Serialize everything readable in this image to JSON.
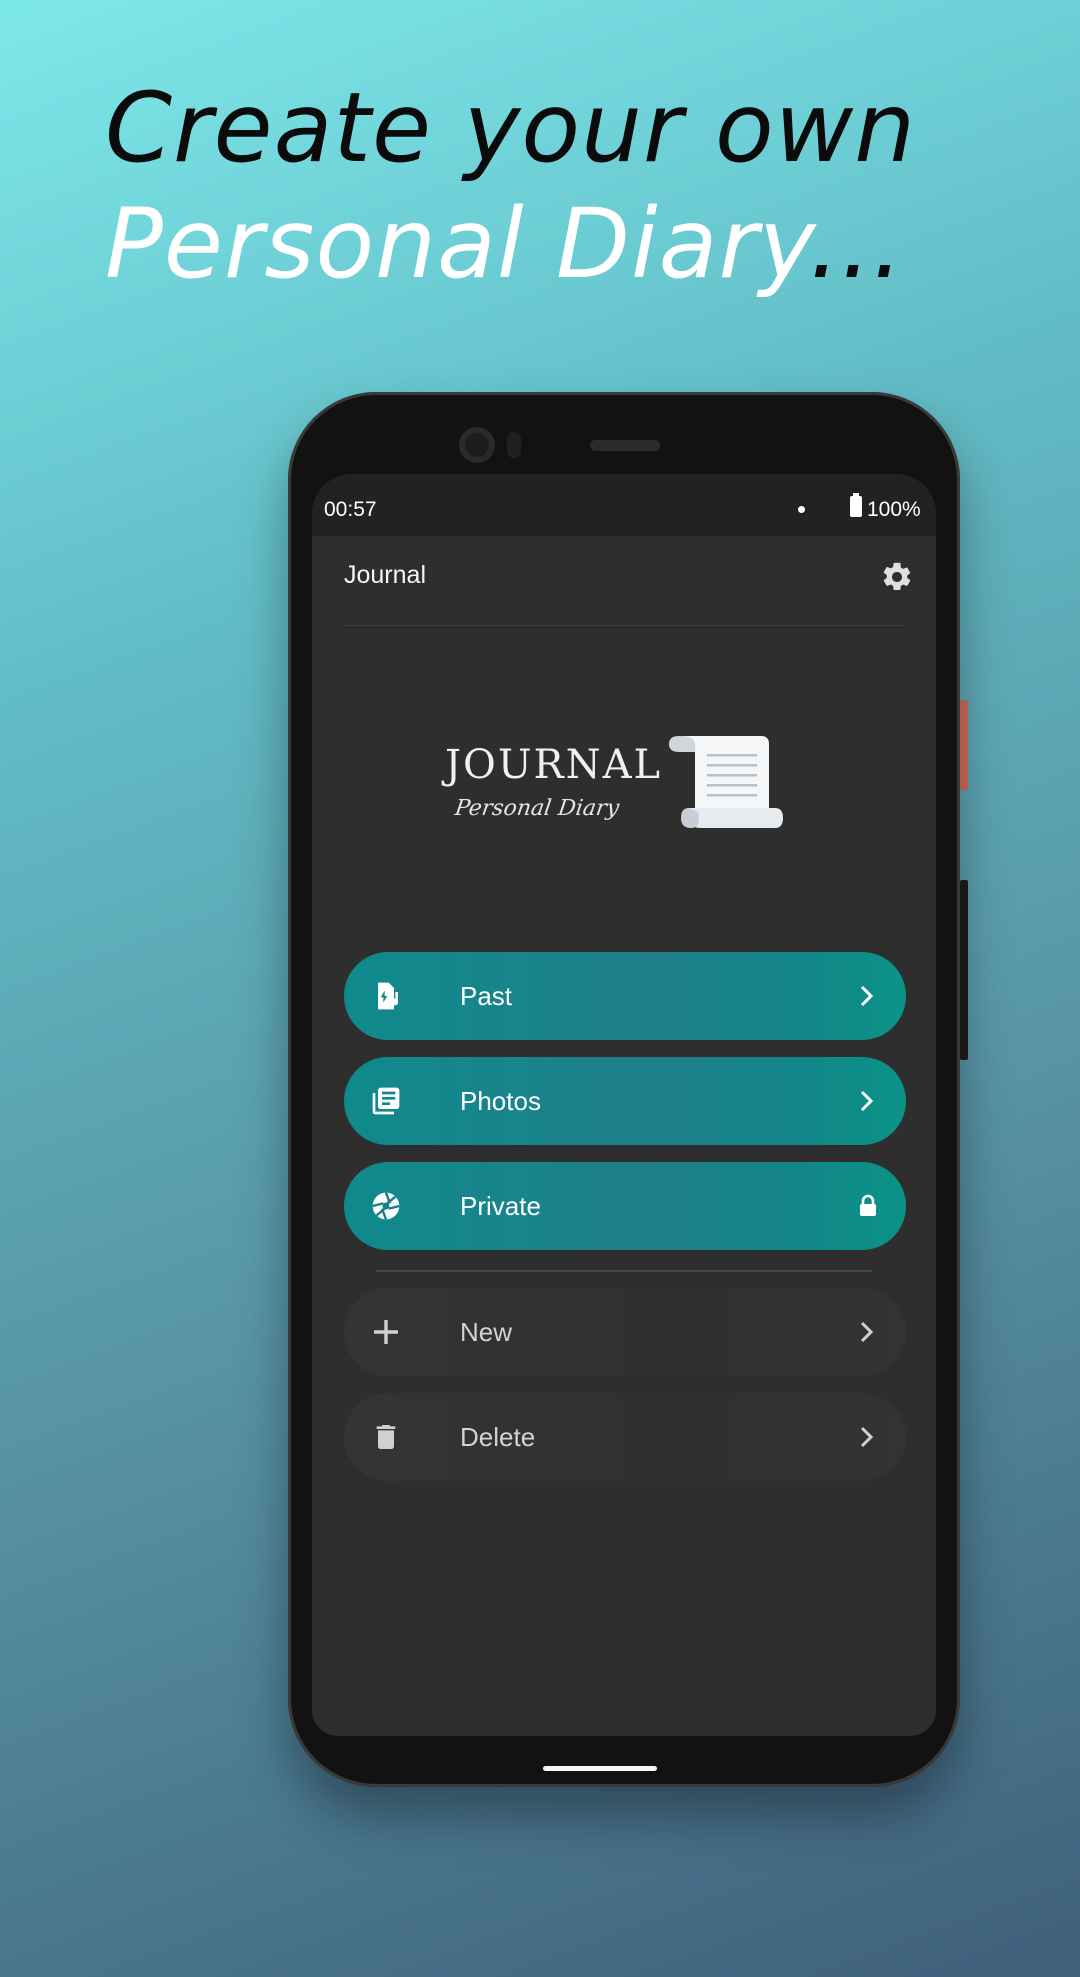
{
  "headline": {
    "line1": "Create your own",
    "line2": "Personal Diary",
    "ellipsis": "..."
  },
  "status_bar": {
    "time": "00:57",
    "battery": "100%"
  },
  "app_bar": {
    "title": "Journal",
    "settings_icon": "gear-icon"
  },
  "logo": {
    "wordmark": "JOURNAL",
    "tagline": "Personal Diary",
    "icon": "scroll-icon"
  },
  "menu": [
    {
      "label": "Past",
      "icon": "history-icon",
      "trailing": "chevron-right-icon",
      "style": "accent"
    },
    {
      "label": "Photos",
      "icon": "library-icon",
      "trailing": "chevron-right-icon",
      "style": "accent"
    },
    {
      "label": "Private",
      "icon": "aperture-icon",
      "trailing": "lock-icon",
      "style": "accent"
    },
    {
      "label": "New",
      "icon": "plus-icon",
      "trailing": "chevron-right-icon",
      "style": "muted"
    },
    {
      "label": "Delete",
      "icon": "trash-icon",
      "trailing": "chevron-right-icon",
      "style": "muted"
    }
  ],
  "colors": {
    "accent": "#0f8a8c",
    "screen_bg": "#2e2e2e",
    "muted_button": "#333333"
  }
}
